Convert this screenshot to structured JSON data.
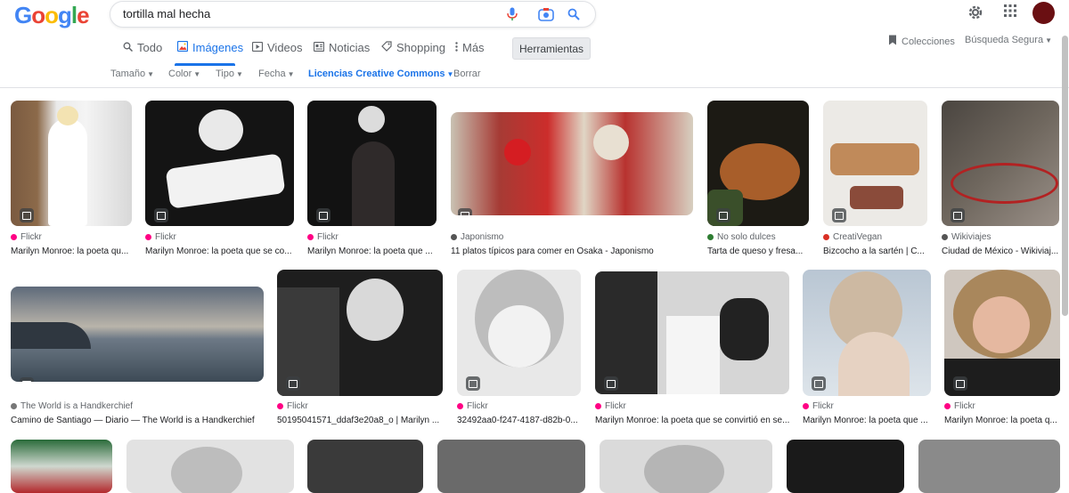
{
  "logo": "Google",
  "search": {
    "query": "tortilla mal hecha"
  },
  "tabs": [
    {
      "label": "Todo",
      "icon": "search-icon"
    },
    {
      "label": "Imágenes",
      "icon": "image-icon"
    },
    {
      "label": "Videos",
      "icon": "video-icon"
    },
    {
      "label": "Noticias",
      "icon": "news-icon"
    },
    {
      "label": "Shopping",
      "icon": "tag-icon"
    },
    {
      "label": "Más",
      "icon": "more-dots-icon"
    }
  ],
  "tools_label": "Herramientas",
  "collections_label": "Colecciones",
  "safe_search_label": "Búsqueda Segura",
  "filters": [
    "Tamaño",
    "Color",
    "Tipo",
    "Fecha",
    "Licencias Creative Commons",
    "Borrar"
  ],
  "results_row1": [
    {
      "source": "Flickr",
      "title": "Marilyn Monroe: la poeta qu..."
    },
    {
      "source": "Flickr",
      "title": "Marilyn Monroe: la poeta que se co..."
    },
    {
      "source": "Flickr",
      "title": "Marilyn Monroe: la poeta que ..."
    },
    {
      "source": "Japonismo",
      "title": "11 platos típicos para comer en Osaka - Japonismo"
    },
    {
      "source": "No solo dulces",
      "title": "Tarta de queso y fresa..."
    },
    {
      "source": "CreatiVegan",
      "title": "Bizcocho a la sartén | C..."
    },
    {
      "source": "Wikiviajes",
      "title": "Ciudad de México - Wikiviaj..."
    }
  ],
  "results_row2": [
    {
      "source": "The World is a Handkerchief",
      "title": "Camino de Santiago — Diario — The World is a Handkerchief"
    },
    {
      "source": "Flickr",
      "title": "50195041571_ddaf3e20a8_o | Marilyn ..."
    },
    {
      "source": "Flickr",
      "title": "32492aa0-f247-4187-d82b-0..."
    },
    {
      "source": "Flickr",
      "title": "Marilyn Monroe: la poeta que se convirtió en se..."
    },
    {
      "source": "Flickr",
      "title": "Marilyn Monroe: la poeta que ..."
    },
    {
      "source": "Flickr",
      "title": "Marilyn Monroe: la poeta q..."
    }
  ],
  "colors": {
    "accent": "#1a73e8",
    "flickr": "#ff0084",
    "avatar": "#6a0f12"
  }
}
